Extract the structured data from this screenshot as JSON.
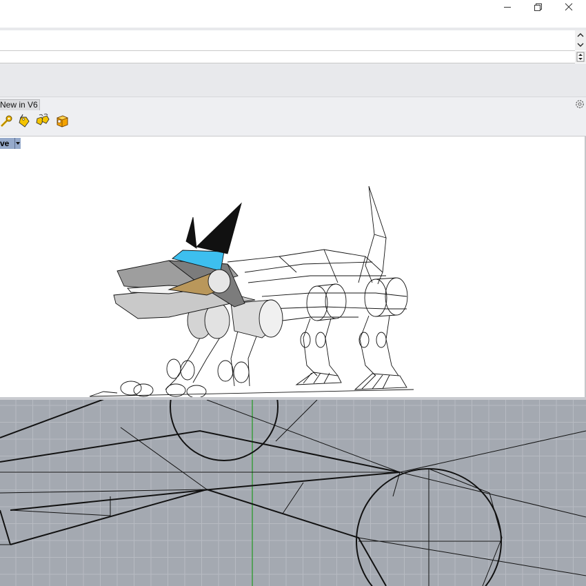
{
  "window": {
    "controls": [
      "minimize-icon",
      "restore-icon",
      "close-icon"
    ]
  },
  "command_area": {
    "history_text": "",
    "prompt_text": ""
  },
  "tabs": [
    {
      "label": "New in V6"
    }
  ],
  "toolbar_icons": [
    "wrench-key-icon",
    "tag-pencil-icon",
    "tags-icon",
    "box-cube-icon"
  ],
  "viewports": {
    "perspective": {
      "title": "ve"
    },
    "top": {
      "title": ""
    }
  },
  "colors": {
    "viewport_title_bg": "#96aacb",
    "top_viewport_bg": "#a4a9b1",
    "shade_cyan": "#3dbfef",
    "shade_gold": "#b9975b",
    "y_axis_green": "#2b9a2b"
  }
}
